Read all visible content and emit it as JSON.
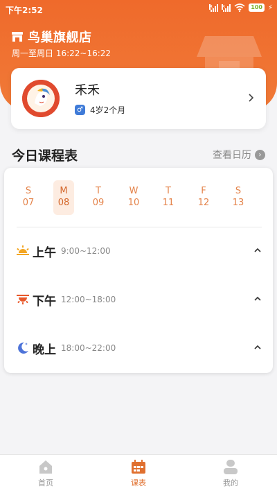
{
  "status_bar": {
    "time": "下午2:52",
    "signal1_label": "R",
    "signal2_label": "R",
    "battery": "100"
  },
  "store": {
    "name": "鸟巢旗舰店",
    "hours": "周一至周日 16:22~16:22"
  },
  "child": {
    "name": "禾禾",
    "gender_symbol": "♂",
    "age": "4岁2个月"
  },
  "schedule": {
    "title": "今日课程表",
    "calendar_link": "查看日历",
    "days": [
      {
        "weekday": "S",
        "date": "07",
        "active": false
      },
      {
        "weekday": "M",
        "date": "08",
        "active": true
      },
      {
        "weekday": "T",
        "date": "09",
        "active": false
      },
      {
        "weekday": "W",
        "date": "10",
        "active": false
      },
      {
        "weekday": "T",
        "date": "11",
        "active": false
      },
      {
        "weekday": "F",
        "date": "12",
        "active": false
      },
      {
        "weekday": "S",
        "date": "13",
        "active": false
      }
    ],
    "periods": [
      {
        "name": "上午",
        "time": "9:00~12:00",
        "icon": "sunrise-icon"
      },
      {
        "name": "下午",
        "time": "12:00~18:00",
        "icon": "sunset-icon"
      },
      {
        "name": "晚上",
        "time": "18:00~22:00",
        "icon": "moon-icon"
      }
    ]
  },
  "tabs": [
    {
      "label": "首页",
      "icon": "home-icon",
      "active": false
    },
    {
      "label": "课表",
      "icon": "calendar-icon",
      "active": true
    },
    {
      "label": "我的",
      "icon": "profile-icon",
      "active": false
    }
  ],
  "colors": {
    "brand": "#ef6a2b",
    "active_tab": "#e0702f",
    "day_text": "#e4834a",
    "day_active_bg": "#fdece1"
  }
}
